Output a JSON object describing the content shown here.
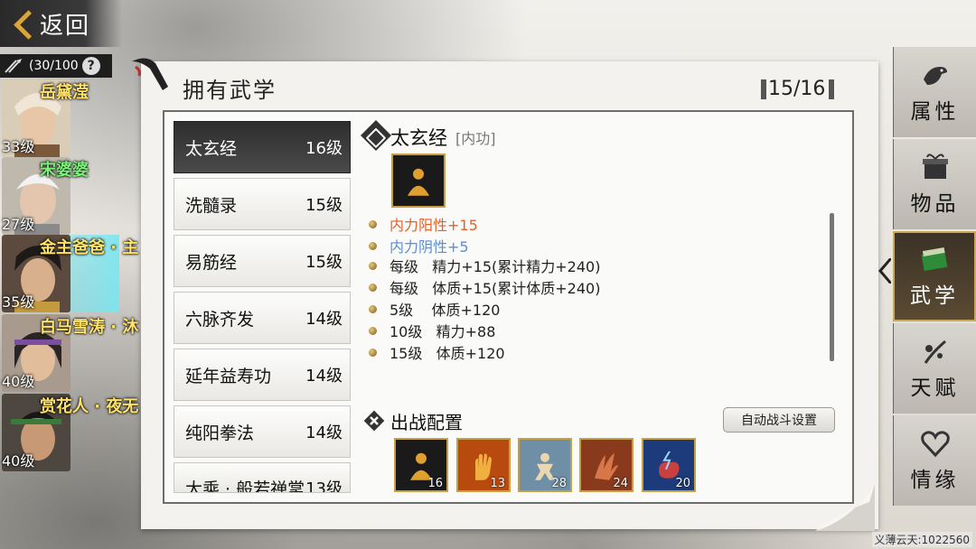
{
  "nav": {
    "back_label": "返回"
  },
  "party": {
    "count_text": "(30/100",
    "help": "?",
    "characters": [
      {
        "name": "岳黛滢",
        "level": "33级"
      },
      {
        "name": "宋婆婆",
        "level": "27级"
      },
      {
        "name": "金主爸爸 · 主",
        "level": "35级"
      },
      {
        "name": "白马雪涛 · 沐",
        "level": "40级"
      },
      {
        "name": "赏花人 · 夜无",
        "level": "40级"
      }
    ]
  },
  "panel": {
    "title": "拥有武学",
    "page": "15/16"
  },
  "skills": [
    {
      "name": "太玄经",
      "level": "16级"
    },
    {
      "name": "洗髓录",
      "level": "15级"
    },
    {
      "name": "易筋经",
      "level": "15级"
    },
    {
      "name": "六脉齐发",
      "level": "14级"
    },
    {
      "name": "延年益寿功",
      "level": "14级"
    },
    {
      "name": "纯阳拳法",
      "level": "14级"
    },
    {
      "name": "大乘 · 般若禅掌",
      "level": "13级"
    }
  ],
  "detail": {
    "name": "太玄经",
    "type": "[内功]",
    "stats": [
      {
        "label": "内力阳性+15",
        "color": "#e0622c"
      },
      {
        "label": "内力阴性+5",
        "color": "#5b8fd0"
      },
      {
        "label": "每级   精力+15(累计精力+240)",
        "color": "#222222"
      },
      {
        "label": "每级   体质+15(累计体质+240)",
        "color": "#222222"
      },
      {
        "label": "5级    体质+120",
        "color": "#222222"
      },
      {
        "label": "10级   精力+88",
        "color": "#222222"
      },
      {
        "label": "15级   体质+120",
        "color": "#222222"
      }
    ]
  },
  "battle": {
    "title": "出战配置",
    "auto_button": "自动战斗设置",
    "slots": [
      {
        "icon": "meditation-icon",
        "level": "16"
      },
      {
        "icon": "palm-icon",
        "level": "13"
      },
      {
        "icon": "stance-icon",
        "level": "28"
      },
      {
        "icon": "claw-icon",
        "level": "24"
      },
      {
        "icon": "lightning-fist-icon",
        "level": "20"
      }
    ]
  },
  "right_nav": [
    {
      "label": "属性",
      "icon": "bird-icon"
    },
    {
      "label": "物品",
      "icon": "box-icon"
    },
    {
      "label": "武学",
      "icon": "book-icon"
    },
    {
      "label": "天赋",
      "icon": "branch-icon"
    },
    {
      "label": "情缘",
      "icon": "heart-icon"
    }
  ],
  "footer": {
    "id_text": "义薄云天:1022560"
  }
}
